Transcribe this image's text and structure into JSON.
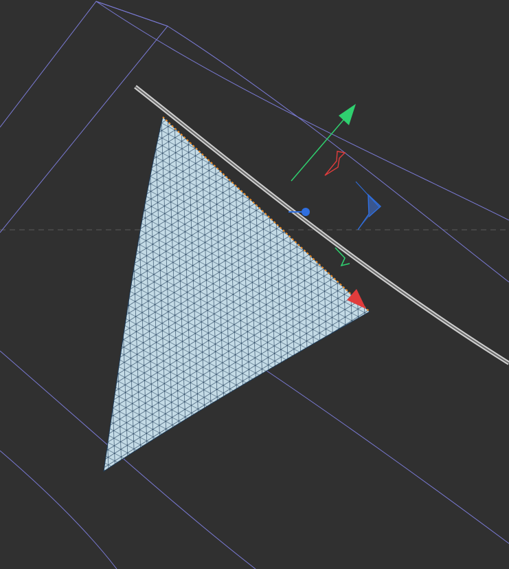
{
  "viewport": {
    "background": "#303030",
    "wireframe_color": "#7b7bd6",
    "mesh_fill": "#c4dbe6",
    "mesh_line": "#1f3b57",
    "selection_color": "#f0902a",
    "rail_color": "#b8b8b8",
    "horizon_dash_color": "#5b5b5b"
  },
  "gizmo": {
    "axis_y_color": "#2fd06f",
    "axis_x_color": "#e03c3c",
    "axis_z_color": "#2f6fe0",
    "icons": [
      "move-y-arrow-icon",
      "move-x-arrow-icon",
      "scale-z-handle-icon",
      "rotate-x-icon",
      "rotate-y-icon",
      "rotate-z-icon"
    ]
  }
}
